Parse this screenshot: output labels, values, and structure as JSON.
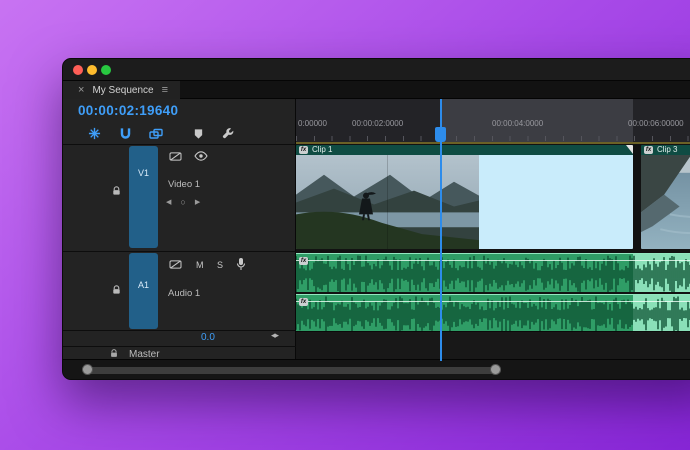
{
  "window": {
    "traffic_lights": [
      "close",
      "minimize",
      "zoom"
    ],
    "tab": {
      "close_glyph": "×",
      "title": "My Sequence",
      "menu_glyph": "≡"
    }
  },
  "timecode": {
    "value": "00:00:02:19640"
  },
  "toolbar": {
    "icons": [
      "nest-toggle-icon",
      "snap-magnet-icon",
      "linked-selection-icon",
      "add-marker-icon",
      "timeline-settings-wrench-icon"
    ]
  },
  "ruler": {
    "labels": [
      "0:00000",
      "00:00:02:0000",
      "00:00:04:0000",
      "00:00:06:00000"
    ]
  },
  "tracks": {
    "video": {
      "target_label": "V1",
      "name": "Video 1",
      "kf_prev": "◀",
      "kf_add": "○",
      "kf_next": "▶"
    },
    "audio": {
      "target_label": "A1",
      "name": "Audio 1",
      "mute": "M",
      "solo": "S",
      "gain": "0.0",
      "pan_glyph": "◂▸"
    },
    "master": {
      "name": "Master"
    }
  },
  "clips": {
    "clip1": {
      "badge": "fx",
      "label": "Clip 1"
    },
    "clip3": {
      "badge": "fx",
      "label": "Clip 3"
    },
    "audio1_badge": "fx",
    "audio2_badge": "fx"
  },
  "colors": {
    "accent_blue": "#3f9ef8",
    "playhead": "#2d8ceb",
    "track_target": "#226089",
    "clip_header": "#0f4c43",
    "selection_fill": "#c9ecfb",
    "audio_clip": "#2f9d66",
    "audio_clip_selected": "#8ae0b8",
    "waveform": "#0b4f31",
    "ruler_highlight": "#3c3d43",
    "bg_gradient_start": "#c873f2",
    "bg_gradient_end": "#8826d8"
  }
}
